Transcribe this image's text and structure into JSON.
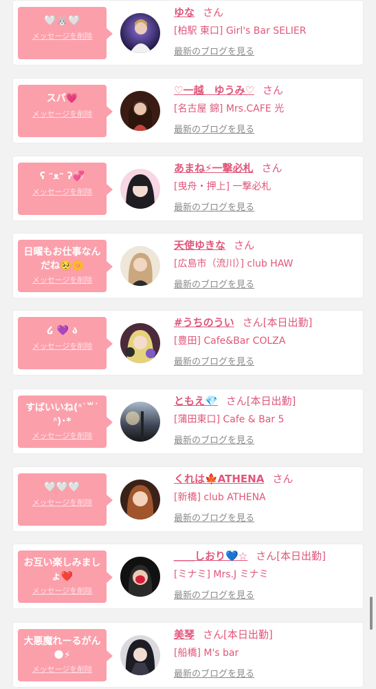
{
  "delete_label": "メッセージを削除",
  "blog_label": "最新のブログを見る",
  "san_label": "さん",
  "entries": [
    {
      "message": "🤍🐰🤍",
      "name": "ゆな",
      "status": "",
      "shop": "[柏駅 東口] Girl's Bar SELIER"
    },
    {
      "message": "スパ💗",
      "name": "♡一越　ゆうみ♡",
      "status": "",
      "shop": "[名古屋 錦] Mrs.CAFE 光"
    },
    {
      "message": "ʕ ᵔᴥᵔ ʔ💞",
      "name": "あまね⚡一撃必札",
      "status": "",
      "shop": "[曳舟・押上] 一撃必札"
    },
    {
      "message": "日曜もお仕事なんだね🥺🌼",
      "name": "天使ゆきな",
      "status": "",
      "shop": "[広島市（流川）] club HAW"
    },
    {
      "message": "໒ 💜 ა",
      "name": "#うちのうい",
      "status": "[本日出勤]",
      "shop": "[豊田] Cafe&Bar COLZA"
    },
    {
      "message": "すばいいね(ᐢ˙꒳˙ᐢ)‪‪･*",
      "name": "ともえ💎",
      "status": "[本日出勤]",
      "shop": "[蒲田東口] Cafe & Bar 5"
    },
    {
      "message": "🤍🤍🤍",
      "name": "くれは🍁ATHENA",
      "status": "",
      "shop": "[新橋] club ATHENA"
    },
    {
      "message": "お互い楽しみましょ❤️",
      "name": "＿＿しおり💙☆",
      "status": "[本日出勤]",
      "shop": "[ミナミ] Mrs.J ミナミ"
    },
    {
      "message": "大悪魔れーるがん🌑⚡",
      "name": "美琴",
      "status": "[本日出勤]",
      "shop": "[船橋] M's bar"
    }
  ],
  "colors": {
    "accent": "#e0567a",
    "bubble": "#fb9fab",
    "background": "#f2f2f2",
    "muted": "#8a8a8a"
  }
}
